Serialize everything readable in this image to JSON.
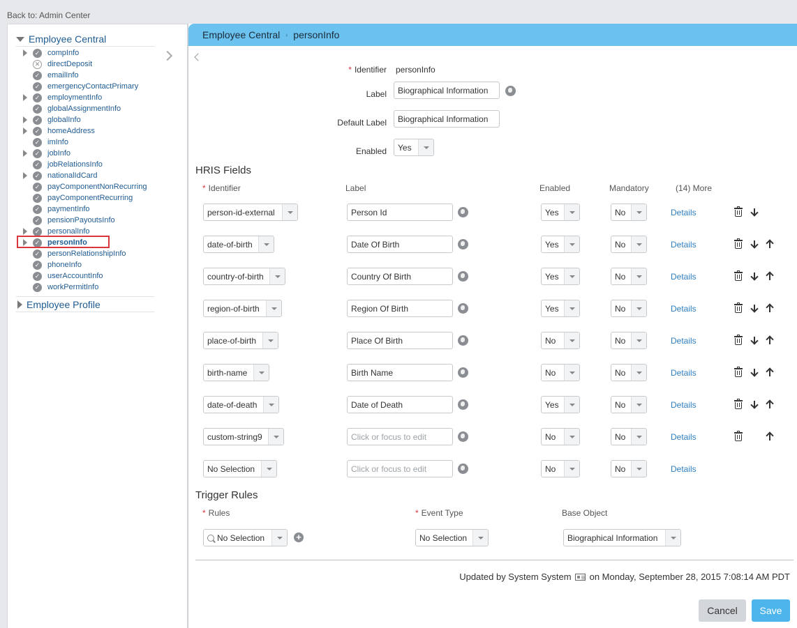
{
  "back_link": "Back to: Admin Center",
  "sidebar": {
    "root1": "Employee Central",
    "items": [
      {
        "label": "compInfo",
        "expandable": true,
        "status": "check"
      },
      {
        "label": "directDeposit",
        "expandable": false,
        "status": "x"
      },
      {
        "label": "emailInfo",
        "expandable": false,
        "status": "check"
      },
      {
        "label": "emergencyContactPrimary",
        "expandable": false,
        "status": "check"
      },
      {
        "label": "employmentInfo",
        "expandable": true,
        "status": "check"
      },
      {
        "label": "globalAssignmentInfo",
        "expandable": false,
        "status": "check"
      },
      {
        "label": "globalInfo",
        "expandable": true,
        "status": "check"
      },
      {
        "label": "homeAddress",
        "expandable": true,
        "status": "check"
      },
      {
        "label": "imInfo",
        "expandable": false,
        "status": "check"
      },
      {
        "label": "jobInfo",
        "expandable": true,
        "status": "check"
      },
      {
        "label": "jobRelationsInfo",
        "expandable": false,
        "status": "check"
      },
      {
        "label": "nationalIdCard",
        "expandable": true,
        "status": "check"
      },
      {
        "label": "payComponentNonRecurring",
        "expandable": false,
        "status": "check"
      },
      {
        "label": "payComponentRecurring",
        "expandable": false,
        "status": "check"
      },
      {
        "label": "paymentInfo",
        "expandable": false,
        "status": "check"
      },
      {
        "label": "pensionPayoutsInfo",
        "expandable": false,
        "status": "check"
      },
      {
        "label": "personalInfo",
        "expandable": true,
        "status": "check"
      },
      {
        "label": "personInfo",
        "expandable": true,
        "status": "check",
        "selected": true
      },
      {
        "label": "personRelationshipInfo",
        "expandable": false,
        "status": "check"
      },
      {
        "label": "phoneInfo",
        "expandable": false,
        "status": "check"
      },
      {
        "label": "userAccountInfo",
        "expandable": false,
        "status": "check"
      },
      {
        "label": "workPermitInfo",
        "expandable": false,
        "status": "check"
      }
    ],
    "root2": "Employee Profile"
  },
  "header": {
    "crumb1": "Employee Central",
    "crumb2": "personInfo"
  },
  "form": {
    "identifier_label": "Identifier",
    "identifier_value": "personInfo",
    "label_label": "Label",
    "label_value": "Biographical Information",
    "default_label_label": "Default Label",
    "default_label_value": "Biographical Information",
    "enabled_label": "Enabled",
    "enabled_value": "Yes"
  },
  "hris": {
    "title": "HRIS Fields",
    "col_identifier": "Identifier",
    "col_label": "Label",
    "col_enabled": "Enabled",
    "col_mandatory": "Mandatory",
    "col_more": "(14) More",
    "details_label": "Details",
    "placeholder": "Click or focus to edit",
    "rows": [
      {
        "identifier": "person-id-external",
        "label": "Person Id",
        "enabled": "Yes",
        "mandatory": "No"
      },
      {
        "identifier": "date-of-birth",
        "label": "Date Of Birth",
        "enabled": "Yes",
        "mandatory": "No"
      },
      {
        "identifier": "country-of-birth",
        "label": "Country Of Birth",
        "enabled": "Yes",
        "mandatory": "No"
      },
      {
        "identifier": "region-of-birth",
        "label": "Region Of Birth",
        "enabled": "Yes",
        "mandatory": "No"
      },
      {
        "identifier": "place-of-birth",
        "label": "Place Of Birth",
        "enabled": "No",
        "mandatory": "No"
      },
      {
        "identifier": "birth-name",
        "label": "Birth Name",
        "enabled": "No",
        "mandatory": "No"
      },
      {
        "identifier": "date-of-death",
        "label": "Date of Death",
        "enabled": "Yes",
        "mandatory": "No"
      },
      {
        "identifier": "custom-string9",
        "label": "",
        "enabled": "No",
        "mandatory": "No"
      },
      {
        "identifier": "No Selection",
        "label": "",
        "enabled": "No",
        "mandatory": "No"
      }
    ]
  },
  "trigger": {
    "title": "Trigger Rules",
    "rules_label": "Rules",
    "rules_value": "No Selection",
    "event_label": "Event Type",
    "event_value": "No Selection",
    "base_label": "Base Object",
    "base_value": "Biographical Information"
  },
  "footer": {
    "updated_prefix": "Updated by System System",
    "updated_suffix": "on Monday, September 28, 2015 7:08:14 AM PDT",
    "cancel": "Cancel",
    "save": "Save"
  }
}
